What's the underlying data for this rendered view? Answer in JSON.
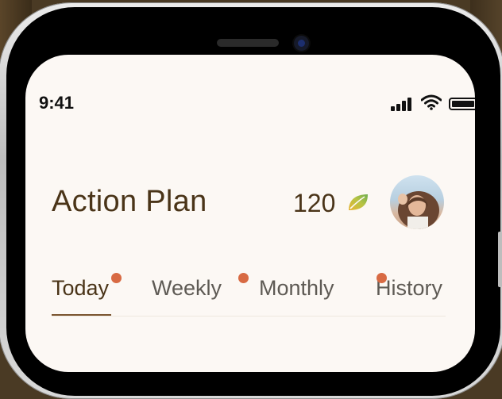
{
  "status_bar": {
    "time": "9:41",
    "icons": [
      "cellular-signal-icon",
      "wifi-icon",
      "battery-icon"
    ]
  },
  "header": {
    "title": "Action Plan",
    "points": "120",
    "points_icon": "leaf-icon",
    "avatar": "profile-avatar"
  },
  "tabs": [
    {
      "label": "Today",
      "active": true,
      "notification": true
    },
    {
      "label": "Weekly",
      "active": false,
      "notification": true
    },
    {
      "label": "Monthly",
      "active": false,
      "notification": false
    },
    {
      "label": "History",
      "active": false,
      "notification": true
    }
  ],
  "colors": {
    "screen_bg": "#fcf8f4",
    "title_text": "#4a3418",
    "tab_inactive": "#5e5a54",
    "notification_dot": "#d86a43",
    "active_underline": "#7a5530"
  }
}
